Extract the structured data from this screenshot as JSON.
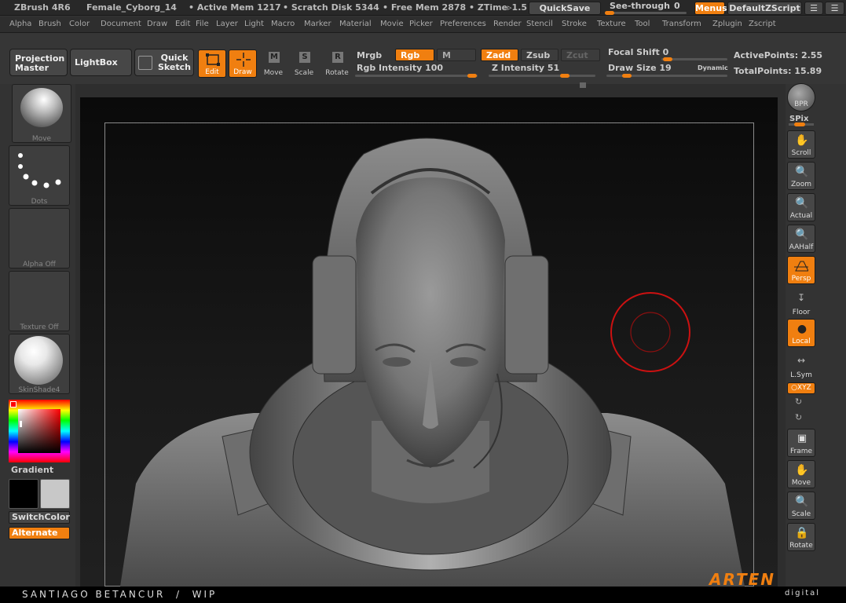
{
  "titlebar": {
    "app": "ZBrush 4R6",
    "document": "Female_Cyborg_14",
    "active_mem": "• Active Mem 1217",
    "scratch_disk": "• Scratch Disk 5344",
    "free_mem": "• Free Mem 2878",
    "ztime": "• ZTime▹1.5",
    "quicksave": "QuickSave",
    "seethrough": "See-through",
    "seethrough_value": "0",
    "menus": "Menus",
    "script": "DefaultZScript"
  },
  "menubar": [
    "Alpha",
    "Brush",
    "Color",
    "Document",
    "Draw",
    "Edit",
    "File",
    "Layer",
    "Light",
    "Macro",
    "Marker",
    "Material",
    "Movie",
    "Picker",
    "Preferences",
    "Render",
    "Stencil",
    "Stroke",
    "Texture",
    "Tool",
    "Transform",
    "Zplugin",
    "Zscript"
  ],
  "toolbar": {
    "projection_master": "Projection Master",
    "lightbox": "LightBox",
    "quick_sketch": "Quick Sketch",
    "edit": "Edit",
    "draw": "Draw",
    "move": "Move",
    "scale": "Scale",
    "rotate": "Rotate",
    "mrgb": "Mrgb",
    "rgb": "Rgb",
    "m": "M",
    "zadd": "Zadd",
    "zsub": "Zsub",
    "zcut": "Zcut",
    "rgb_intensity": "Rgb Intensity 100",
    "z_intensity": "Z Intensity 51",
    "focal_shift": "Focal Shift 0",
    "draw_size": "Draw Size 19",
    "dynamic": "Dynamic",
    "active_points": "ActivePoints: 2.55",
    "total_points": "TotalPoints: 15.89"
  },
  "leftshelf": {
    "brush": "Move",
    "stroke": "Dots",
    "alpha": "Alpha Off",
    "texture": "Texture Off",
    "material": "SkinShade4",
    "gradient": "Gradient",
    "switchcolor": "SwitchColor",
    "alternate": "Alternate"
  },
  "rightshelf": {
    "bpr": "BPR",
    "spix": "SPix",
    "scroll": "Scroll",
    "zoom": "Zoom",
    "actual": "Actual",
    "aahalf": "AAHalf",
    "persp": "Persp",
    "floor": "Floor",
    "local": "Local",
    "lsym": "L.Sym",
    "xyz": "○XYZ",
    "frame": "Frame",
    "move": "Move",
    "scale": "Scale",
    "rotate": "Rotate"
  },
  "footer": {
    "credit": "SANTIAGO BETANCUR  /  WIP",
    "logo_brand": "ARTEN",
    "logo_sub": "digital"
  },
  "colors": {
    "accent": "#f07f10",
    "panel": "#333333",
    "button": "#474747",
    "brush_cursor": "#cc1111"
  }
}
